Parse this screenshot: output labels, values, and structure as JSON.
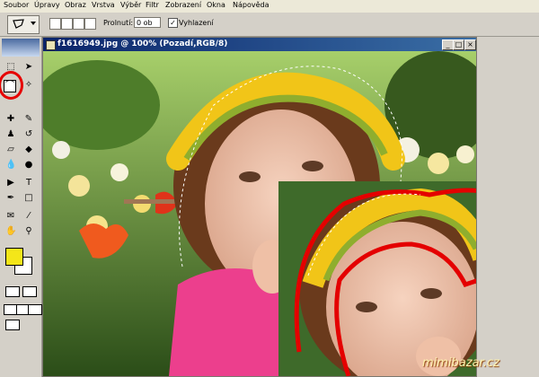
{
  "menu": [
    "Soubor",
    "Úpravy",
    "Obraz",
    "Vrstva",
    "Výběr",
    "Filtr",
    "Zobrazení",
    "Okna",
    "Nápověda"
  ],
  "options": {
    "feather_label": "Prolnutí:",
    "feather_value": "0 ob",
    "antialias_label": "Vyhlazení",
    "antialias_checked": "✓"
  },
  "document": {
    "title": "f1616949.jpg @ 100% (Pozadí,RGB/8)"
  },
  "watermark": "mimibazar.cz",
  "colors": {
    "foreground": "#f4e619",
    "background": "#ffffff",
    "highlight_circle": "#e60000"
  }
}
